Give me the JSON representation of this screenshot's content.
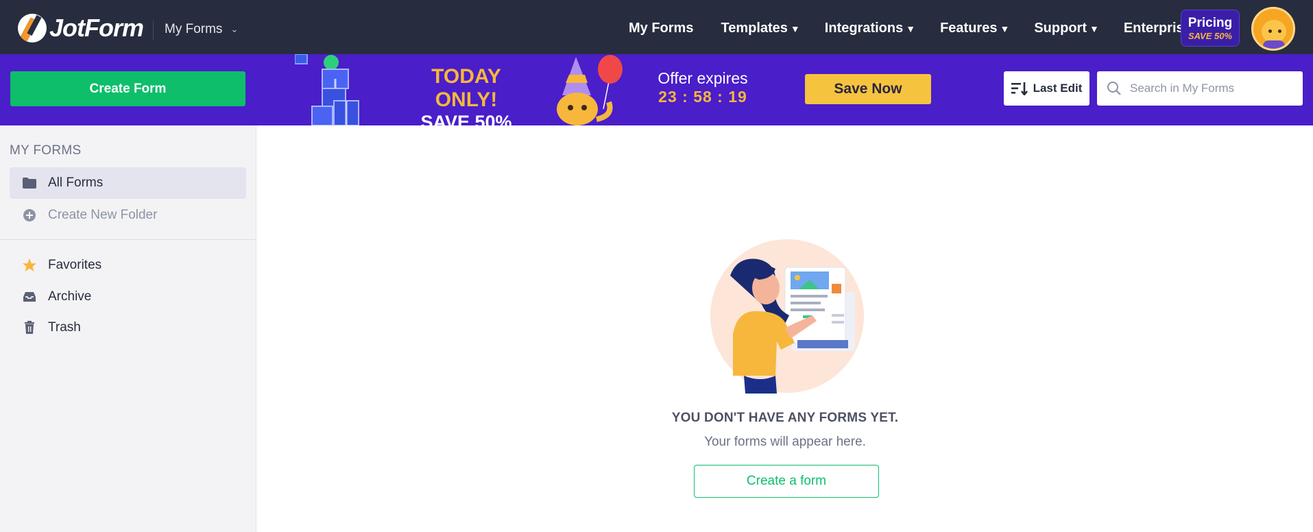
{
  "header": {
    "logo_text": "JotForm",
    "myforms_dropdown": "My Forms",
    "nav": [
      {
        "label": "My Forms",
        "has_arrow": false
      },
      {
        "label": "Templates",
        "has_arrow": true
      },
      {
        "label": "Integrations",
        "has_arrow": true
      },
      {
        "label": "Features",
        "has_arrow": true
      },
      {
        "label": "Support",
        "has_arrow": true
      },
      {
        "label": "Enterprise",
        "has_arrow": false
      }
    ],
    "pricing": {
      "label": "Pricing",
      "badge": "SAVE 50%"
    }
  },
  "promo": {
    "create_form": "Create Form",
    "today_only": "TODAY ONLY!",
    "save": "SAVE 50%",
    "offer_label": "Offer expires",
    "countdown": "23 : 58 : 19",
    "save_now": "Save Now",
    "sort_label": "Last Edit",
    "search_placeholder": "Search in My Forms"
  },
  "sidebar": {
    "title": "MY FORMS",
    "all_forms": "All Forms",
    "create_folder": "Create New Folder",
    "favorites": "Favorites",
    "archive": "Archive",
    "trash": "Trash"
  },
  "empty_state": {
    "title": "YOU DON'T HAVE ANY FORMS YET.",
    "subtitle": "Your forms will appear here.",
    "button": "Create a form"
  },
  "colors": {
    "nav_bg": "#272d3e",
    "promo_bg": "#4a1ec9",
    "green": "#0ebe6b",
    "yellow": "#f6c33f",
    "orange_text": "#f6b73c"
  }
}
